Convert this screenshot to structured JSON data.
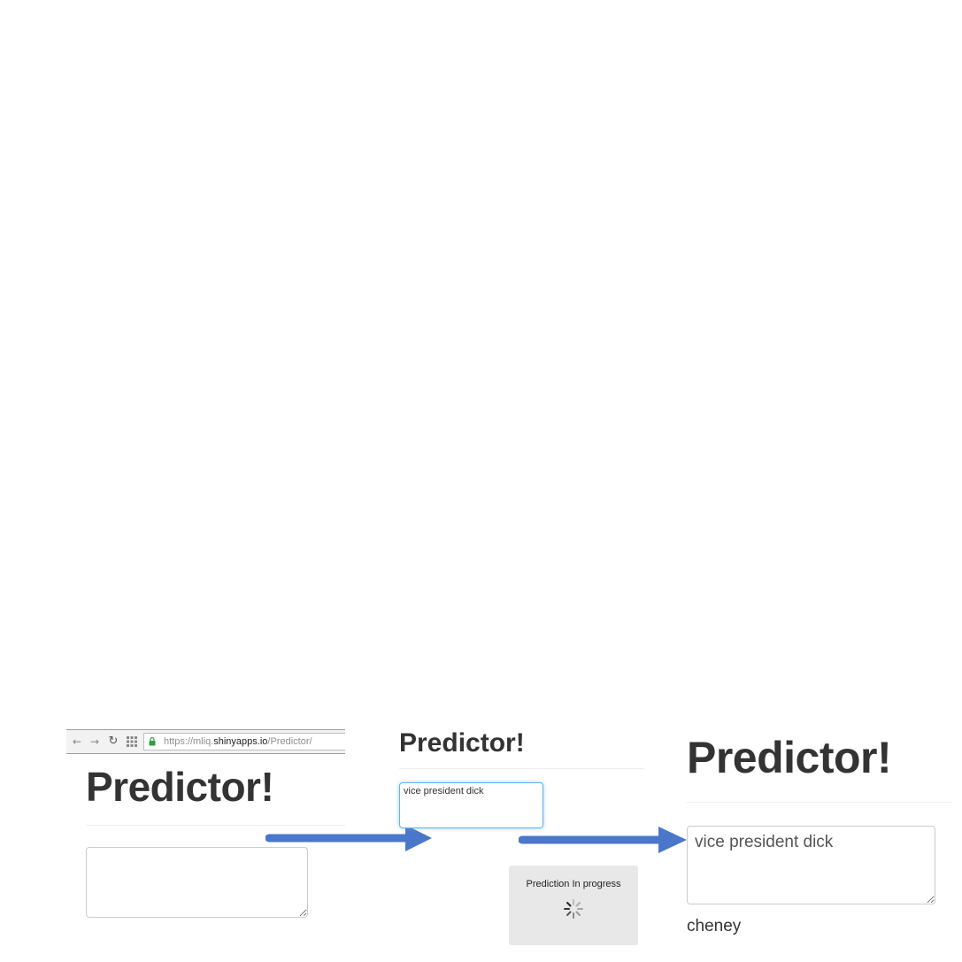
{
  "panel1": {
    "browser": {
      "url_prefix": "https://mliq.",
      "url_host": "shinyapps.io",
      "url_path": "/Predictor/",
      "icons": [
        "back-icon",
        "forward-icon",
        "reload-icon",
        "apps-icon",
        "lock-icon"
      ]
    },
    "title": "Predictor!",
    "input_value": ""
  },
  "panel2": {
    "title": "Predictor!",
    "input_value": "vice president dick ",
    "progress_label": "Prediction In progress"
  },
  "panel3": {
    "title": "Predictor!",
    "input_value": "vice president dick",
    "prediction": "cheney"
  },
  "colors": {
    "arrow": "#4a77c9",
    "focus_border": "#66afe9",
    "lock": "#2e9e3e",
    "progress_bg": "#e8e8e8"
  }
}
